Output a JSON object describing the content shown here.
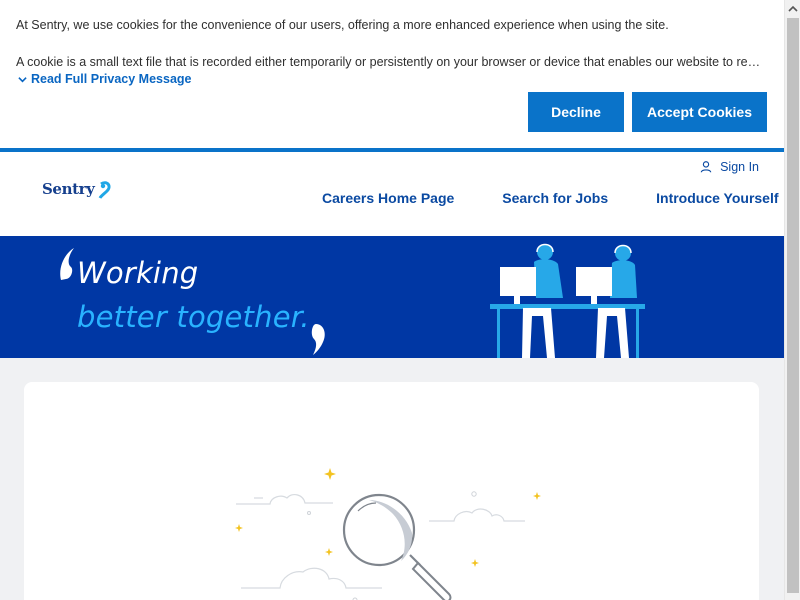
{
  "cookie_banner": {
    "line_1": "At Sentry, we use cookies for the convenience of our users, offering a more enhanced experience when using the site.",
    "line_2": "A cookie is a small text file that is recorded either temporarily or persistently on your browser or device that enables our website to rememb…",
    "read_more_label": "Read Full Privacy Message",
    "decline_label": "Decline",
    "accept_label": "Accept Cookies",
    "button_color": "#0a73c9"
  },
  "header": {
    "logo_text": "Sentry",
    "sign_in_label": "Sign In",
    "nav_items": [
      {
        "label": "Careers Home Page"
      },
      {
        "label": "Search for Jobs"
      },
      {
        "label": "Introduce Yourself"
      }
    ],
    "nav_color": "#0b4aa2"
  },
  "hero": {
    "line_1": "Working",
    "line_2": "better together.",
    "background_color": "#0037a4",
    "accent_color": "#29b3ff"
  },
  "icons": {
    "chevron": "chevron-down-icon",
    "user": "user-icon",
    "search": "magnifying-glass-icon"
  }
}
